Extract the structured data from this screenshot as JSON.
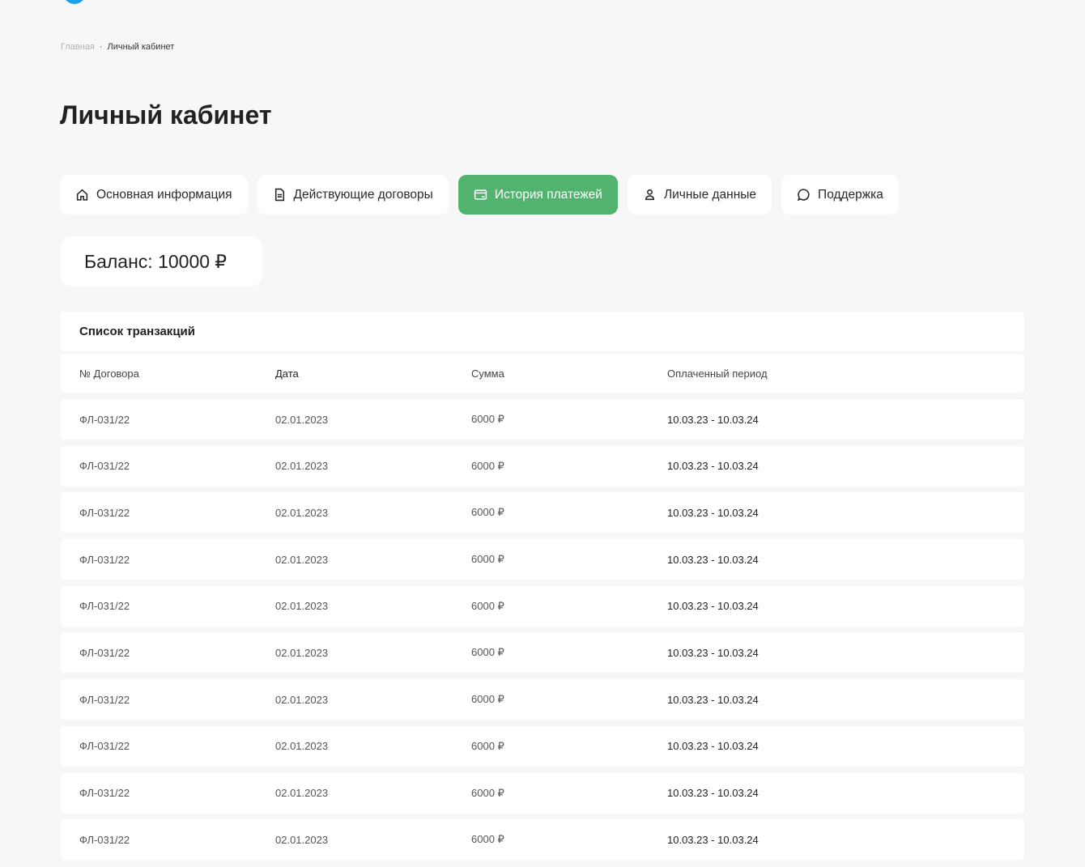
{
  "breadcrumb": {
    "home": "Главная",
    "separator": "·",
    "current": "Личный кабинет"
  },
  "page_title": "Личный кабинет",
  "tabs": [
    {
      "label": "Основная информация",
      "icon": "home-icon",
      "active": false
    },
    {
      "label": "Действующие договоры",
      "icon": "document-icon",
      "active": false
    },
    {
      "label": "История платежей",
      "icon": "card-icon",
      "active": true
    },
    {
      "label": "Личные данные",
      "icon": "user-icon",
      "active": false
    },
    {
      "label": "Поддержка",
      "icon": "chat-icon",
      "active": false
    }
  ],
  "balance": "Баланс: 10000 ₽",
  "transactions": {
    "title": "Список транзакций",
    "columns": [
      "№ Договора",
      "Дата",
      "Сумма",
      "Оплаченный период"
    ],
    "rows": [
      [
        "ФЛ-031/22",
        "02.01.2023",
        "6000 ₽",
        "10.03.23 - 10.03.24"
      ],
      [
        "ФЛ-031/22",
        "02.01.2023",
        "6000 ₽",
        "10.03.23 - 10.03.24"
      ],
      [
        "ФЛ-031/22",
        "02.01.2023",
        "6000 ₽",
        "10.03.23 - 10.03.24"
      ],
      [
        "ФЛ-031/22",
        "02.01.2023",
        "6000 ₽",
        "10.03.23 - 10.03.24"
      ],
      [
        "ФЛ-031/22",
        "02.01.2023",
        "6000 ₽",
        "10.03.23 - 10.03.24"
      ],
      [
        "ФЛ-031/22",
        "02.01.2023",
        "6000 ₽",
        "10.03.23 - 10.03.24"
      ],
      [
        "ФЛ-031/22",
        "02.01.2023",
        "6000 ₽",
        "10.03.23 - 10.03.24"
      ],
      [
        "ФЛ-031/22",
        "02.01.2023",
        "6000 ₽",
        "10.03.23 - 10.03.24"
      ],
      [
        "ФЛ-031/22",
        "02.01.2023",
        "6000 ₽",
        "10.03.23 - 10.03.24"
      ],
      [
        "ФЛ-031/22",
        "02.01.2023",
        "6000 ₽",
        "10.03.23 - 10.03.24"
      ]
    ]
  },
  "colors": {
    "accent": "#52b36f",
    "logo": "#1aa3e8",
    "background": "#f7f7f7"
  }
}
